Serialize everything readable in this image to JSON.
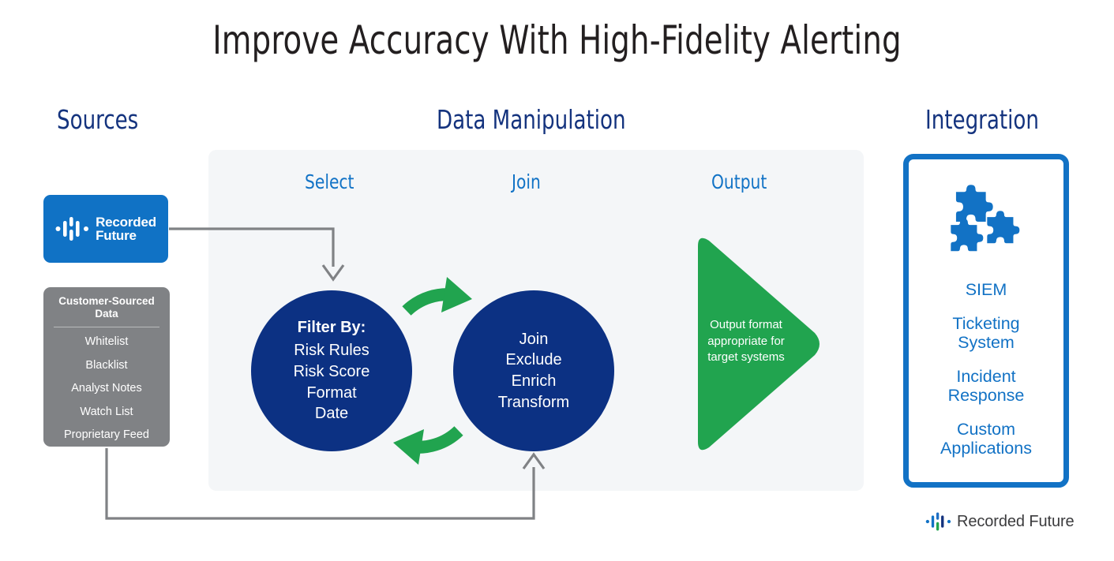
{
  "title": "Improve Accuracy With High-Fidelity Alerting",
  "columns": {
    "sources": "Sources",
    "data_manipulation": "Data Manipulation",
    "integration": "Integration"
  },
  "stages": {
    "select": "Select",
    "join": "Join",
    "output": "Output"
  },
  "sources": {
    "recorded_future": {
      "line1": "Recorded",
      "line2": "Future",
      "icon": "recorded-future-mark"
    },
    "customer_sourced": {
      "title": "Customer-Sourced Data",
      "items": [
        "Whitelist",
        "Blacklist",
        "Analyst Notes",
        "Watch List",
        "Proprietary Feed"
      ]
    }
  },
  "select_circle": {
    "title": "Filter By:",
    "items": [
      "Risk Rules",
      "Risk Score",
      "Format",
      "Date"
    ]
  },
  "join_circle": {
    "items": [
      "Join",
      "Exclude",
      "Enrich",
      "Transform"
    ]
  },
  "output": {
    "text": "Output format appropriate for target systems"
  },
  "integration": {
    "icon": "puzzle-pieces-icon",
    "items": [
      "SIEM",
      "Ticketing\nSystem",
      "Incident\nResponse",
      "Custom\nApplications"
    ]
  },
  "footer": {
    "brand": "Recorded Future",
    "icon": "recorded-future-mark"
  },
  "colors": {
    "navy": "#0C3183",
    "heading_navy": "#14337E",
    "blue": "#1272C5",
    "logo_blue": "#1072C5",
    "green": "#21A44F",
    "gray_box": "#808285",
    "panel_bg": "#F4F6F8",
    "connector_gray": "#808285",
    "title_text": "#231F20"
  }
}
